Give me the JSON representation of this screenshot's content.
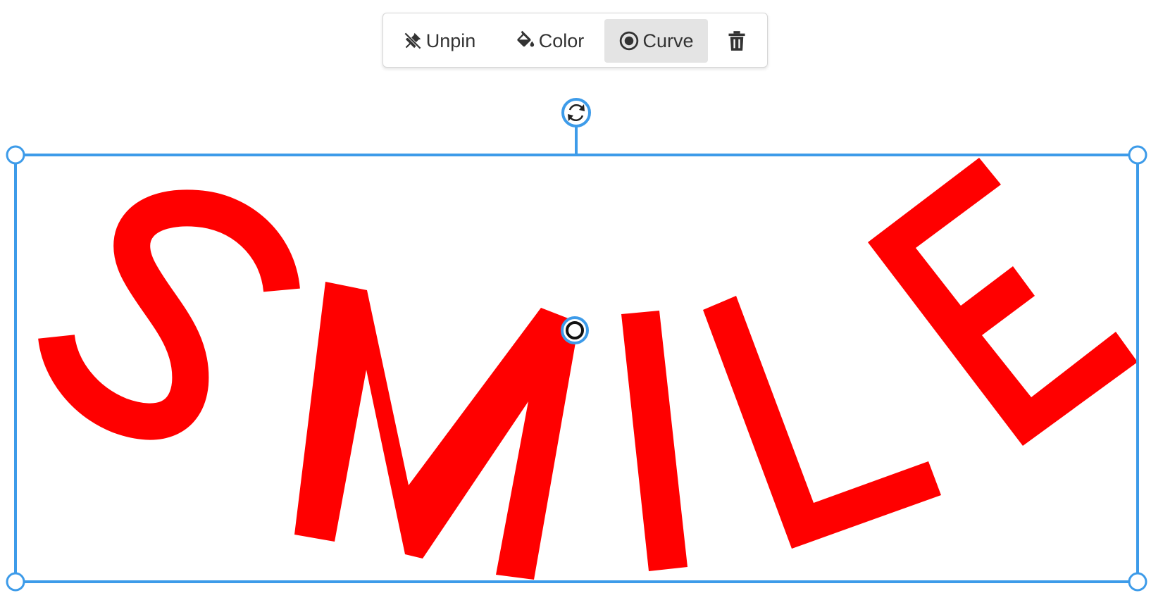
{
  "toolbar": {
    "unpin_label": "Unpin",
    "color_label": "Color",
    "curve_label": "Curve",
    "delete_icon": "trash-icon",
    "active_button": "Curve"
  },
  "text_object": {
    "text": "SMILE",
    "letters": [
      "S",
      "M",
      "I",
      "L",
      "E"
    ],
    "fill_color": "#ff0000",
    "curved": true
  },
  "selection": {
    "accent_color": "#3d9be9",
    "rotate_icon": "rotate-icon",
    "curve_handle_icon": "curve-handle-icon"
  },
  "colors": {
    "icon": "#333333",
    "active_bg": "#e4e4e4",
    "toolbar_border": "#d6d6d6"
  }
}
